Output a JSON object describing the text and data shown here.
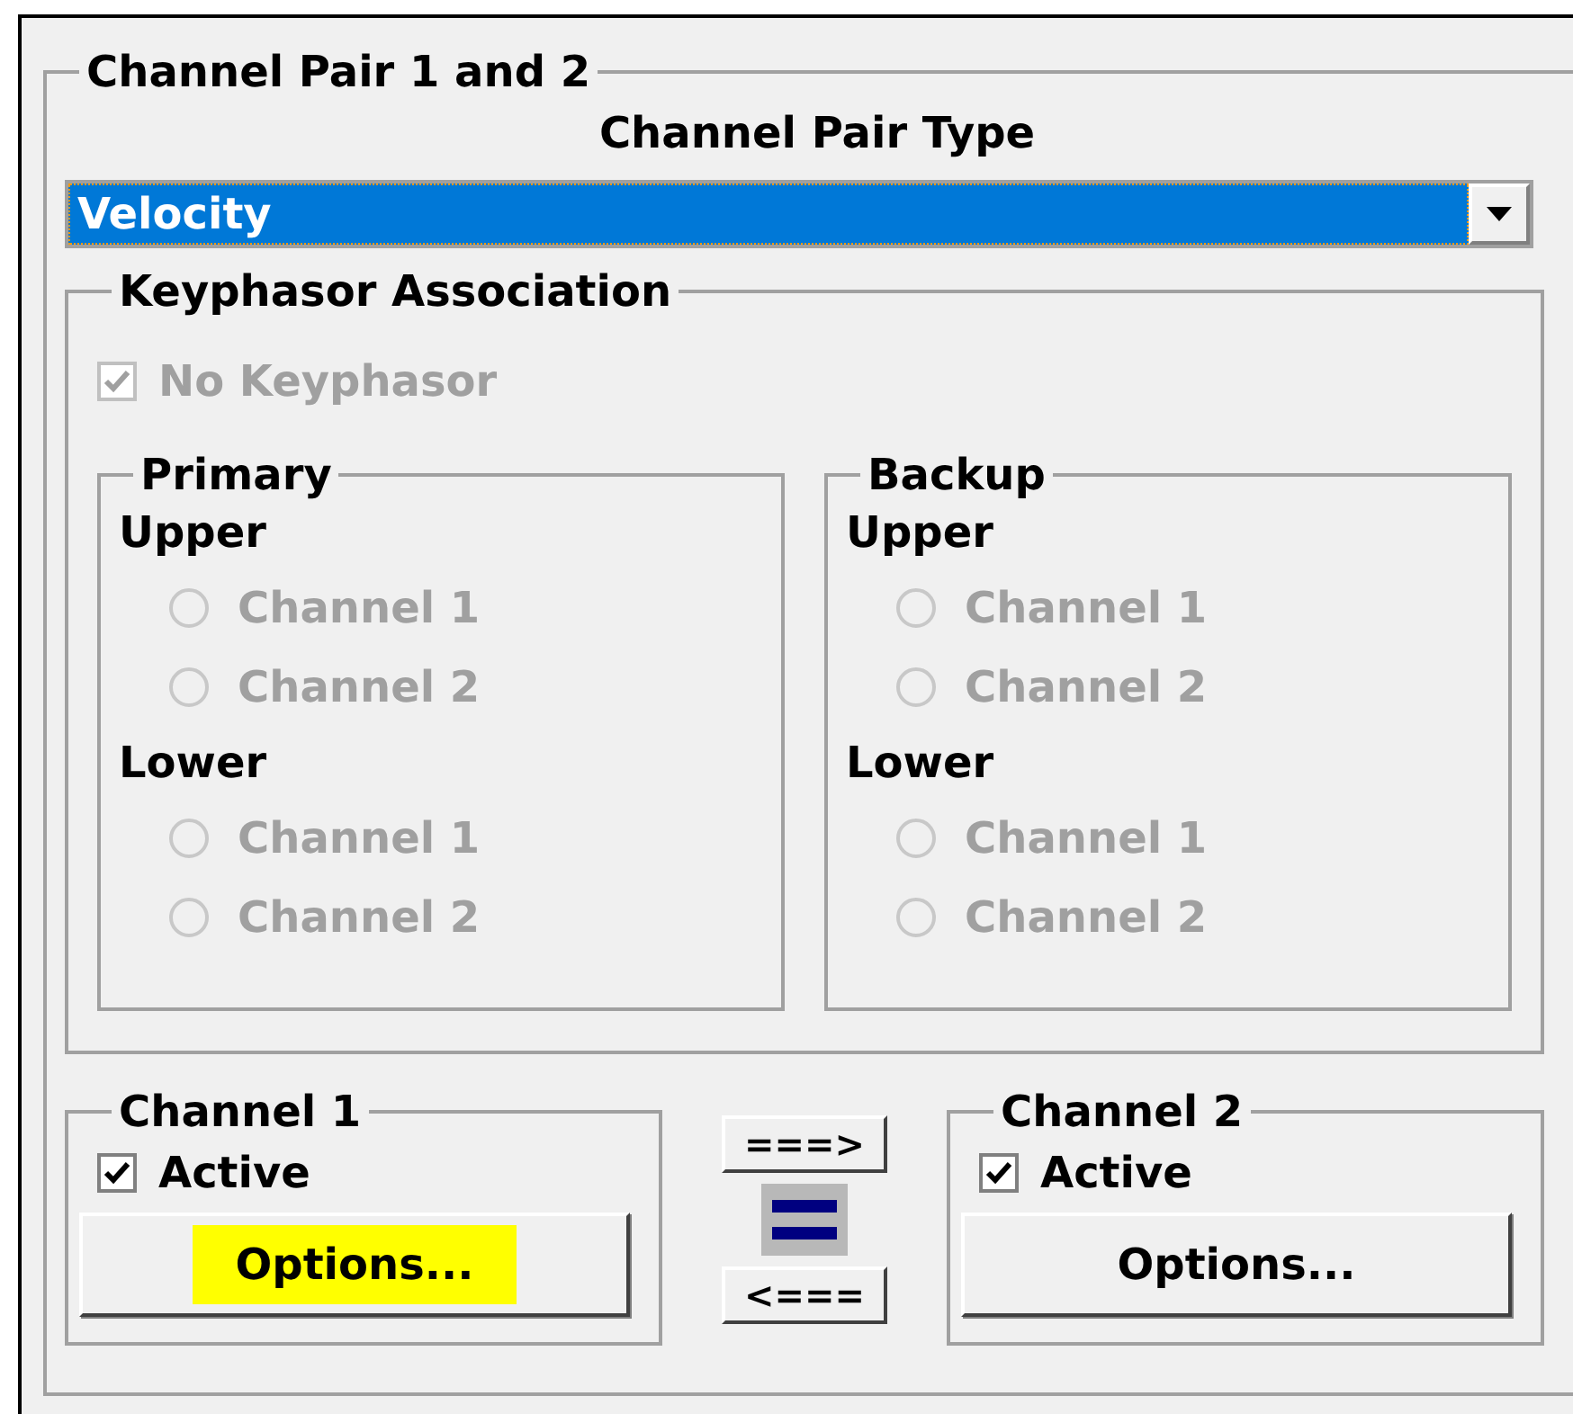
{
  "group": {
    "title": "Channel Pair 1 and 2",
    "type_label": "Channel Pair Type",
    "type_value": "Velocity",
    "keyphasor": {
      "title": "Keyphasor Association",
      "no_keyphasor": {
        "label": "No Keyphasor",
        "checked": true,
        "disabled": true
      },
      "sets": [
        {
          "title": "Primary",
          "sections": [
            {
              "label": "Upper",
              "options": [
                {
                  "label": "Channel 1",
                  "selected": false,
                  "disabled": true
                },
                {
                  "label": "Channel 2",
                  "selected": false,
                  "disabled": true
                }
              ]
            },
            {
              "label": "Lower",
              "options": [
                {
                  "label": "Channel 1",
                  "selected": false,
                  "disabled": true
                },
                {
                  "label": "Channel 2",
                  "selected": false,
                  "disabled": true
                }
              ]
            }
          ]
        },
        {
          "title": "Backup",
          "sections": [
            {
              "label": "Upper",
              "options": [
                {
                  "label": "Channel 1",
                  "selected": false,
                  "disabled": true
                },
                {
                  "label": "Channel 2",
                  "selected": false,
                  "disabled": true
                }
              ]
            },
            {
              "label": "Lower",
              "options": [
                {
                  "label": "Channel 1",
                  "selected": false,
                  "disabled": true
                },
                {
                  "label": "Channel 2",
                  "selected": false,
                  "disabled": true
                }
              ]
            }
          ]
        }
      ]
    },
    "channels": [
      {
        "title": "Channel 1",
        "active": {
          "label": "Active",
          "checked": true
        },
        "button": {
          "label": "Options...",
          "highlighted": true
        }
      },
      {
        "title": "Channel 2",
        "active": {
          "label": "Active",
          "checked": true
        },
        "button": {
          "label": "Options...",
          "highlighted": false
        }
      }
    ],
    "swap": {
      "right": "===>",
      "left": "<==="
    }
  }
}
